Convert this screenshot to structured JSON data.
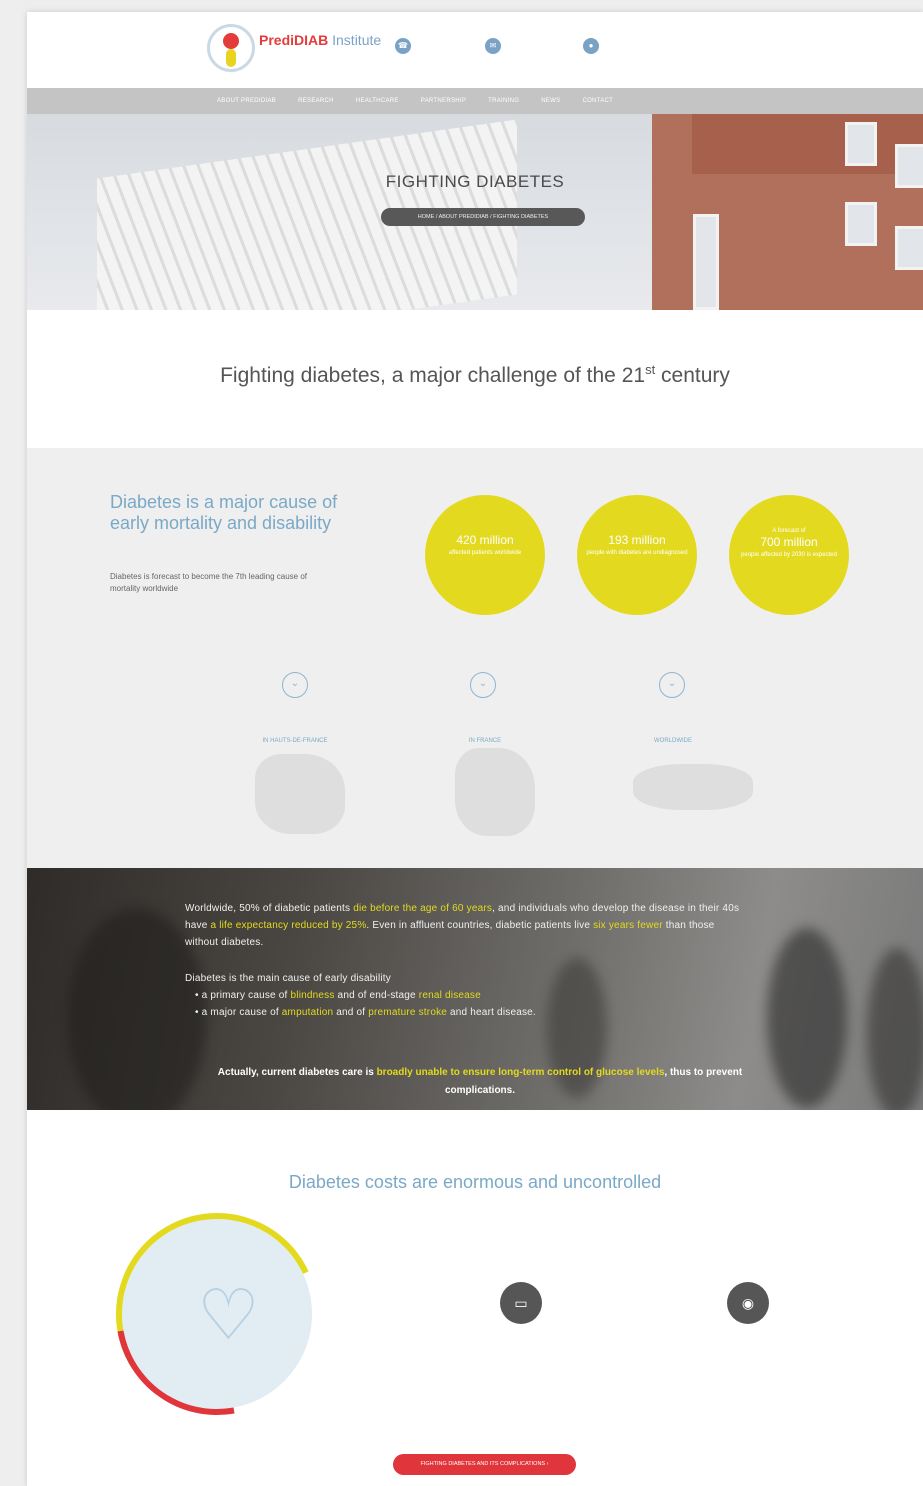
{
  "header": {
    "brand_main": "PrediDIAB",
    "brand_rest": " Institute",
    "brand_tagline": "",
    "phone": "",
    "email": "",
    "address": ""
  },
  "nav": [
    "About PrediDIAB",
    "Research",
    "Healthcare",
    "Partnership",
    "Training",
    "News",
    "Contact"
  ],
  "hero": {
    "title": "FIGHTING DIABETES",
    "breadcrumb": "HOME / ABOUT PREDIDIAB / FIGHTING DIABETES"
  },
  "section1": {
    "heading_main": "Fighting diabetes, a major challenge of the 21",
    "heading_sup": "st",
    "heading_end": " century"
  },
  "cause": {
    "title": "Diabetes is a major cause of early mortality and disability",
    "text": "Diabetes is forecast to become the 7th leading cause of mortality worldwide",
    "source": ""
  },
  "stats": [
    {
      "big": "420 million",
      "small": "affected patients worldwide",
      "pre": ""
    },
    {
      "big": "193 million",
      "small": "people with diabetes are undiagnosed",
      "pre": ""
    },
    {
      "big": "700 million",
      "small": "people affected by 2030 is expected",
      "pre": "A forecast of"
    }
  ],
  "columns": [
    {
      "heading": "IN HAUTS-DE-FRANCE",
      "text": ""
    },
    {
      "heading": "IN FRANCE",
      "text": ""
    },
    {
      "heading": "WORLDWIDE",
      "text": ""
    }
  ],
  "band": {
    "p1_a": "Worldwide, 50% of diabetic patients ",
    "p1_b": "die before the age of 60 years",
    "p1_c": ", and individuals who develop the disease in their 40s have ",
    "p1_d": "a life expectancy reduced by 25%",
    "p1_e": ". Even in affluent countries, diabetic patients live ",
    "p1_f": "six years fewer",
    "p1_g": " than those without diabetes.",
    "p2_intro": "Diabetes is the main cause of early disability",
    "p2_l1_a": "• a primary cause of ",
    "p2_l1_b": "blindness",
    "p2_l1_c": " and of end-stage ",
    "p2_l1_d": "renal disease",
    "p2_l2_a": "• a major cause of ",
    "p2_l2_b": "amputation",
    "p2_l2_c": " and of ",
    "p2_l2_d": "premature stroke",
    "p2_l2_e": " and heart disease.",
    "strong_a": "Actually, current diabetes care is ",
    "strong_b": "broadly unable to ensure long-term control of glucose levels",
    "strong_c": ", thus to prevent complications."
  },
  "costs": {
    "heading": "Diabetes costs are enormous and uncontrolled",
    "text": "",
    "items": [
      {
        "title": "",
        "note": ""
      },
      {
        "title": "",
        "note": ""
      }
    ],
    "button": "FIGHTING DIABETES AND ITS COMPLICATIONS"
  },
  "colors": {
    "accent_blue": "#7aa9c7",
    "yellow": "#e3da1f",
    "red": "#e0363b"
  }
}
